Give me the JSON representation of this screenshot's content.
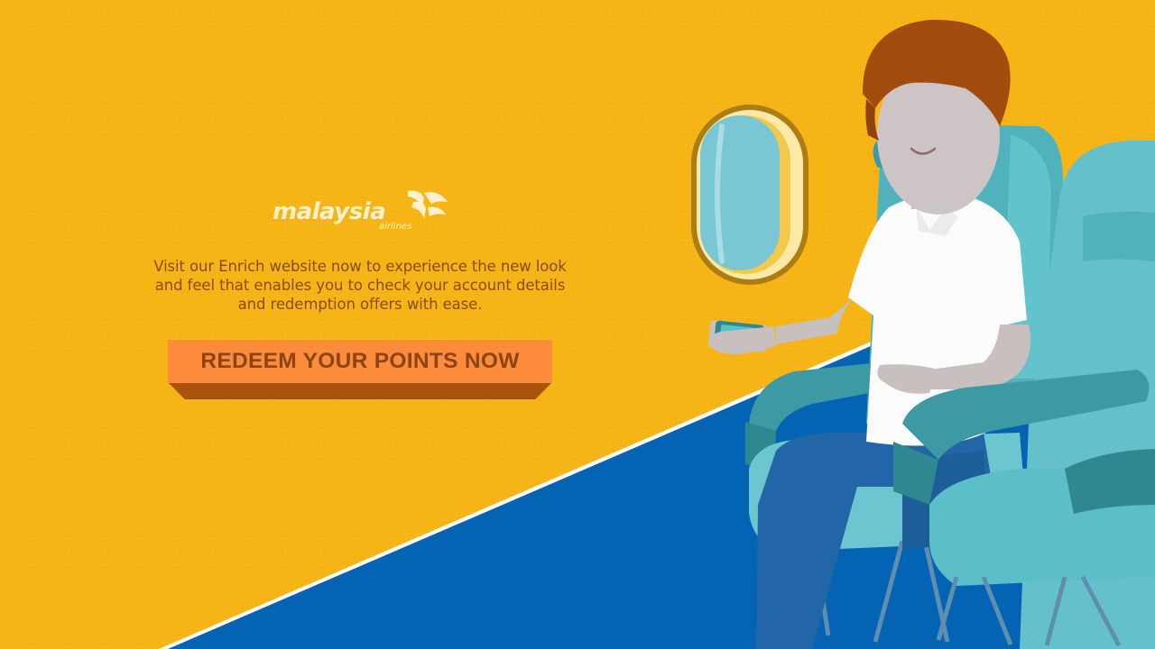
{
  "brand": {
    "name": "malaysia",
    "subname": "airlines",
    "logo_mark": "airline-emblem-icon"
  },
  "message": "Visit our Enrich website now to experience the new look and feel that enables you to check your account details and redemption offers with ease.",
  "cta": {
    "label": "REDEEM YOUR POINTS NOW"
  },
  "colors": {
    "background": "#f6b412",
    "floor": "#0563b4",
    "button": "#fc8b3b",
    "button_shadow": "#a9530d",
    "text": "#8a4a0c",
    "seat": "#5bbec8",
    "hair": "#a24d0e",
    "shirt": "#ffffff",
    "pants": "#2266a7"
  },
  "illustration": {
    "elements": [
      "airplane-window",
      "passenger",
      "smartphone",
      "passenger-seat",
      "cabin-floor"
    ]
  }
}
